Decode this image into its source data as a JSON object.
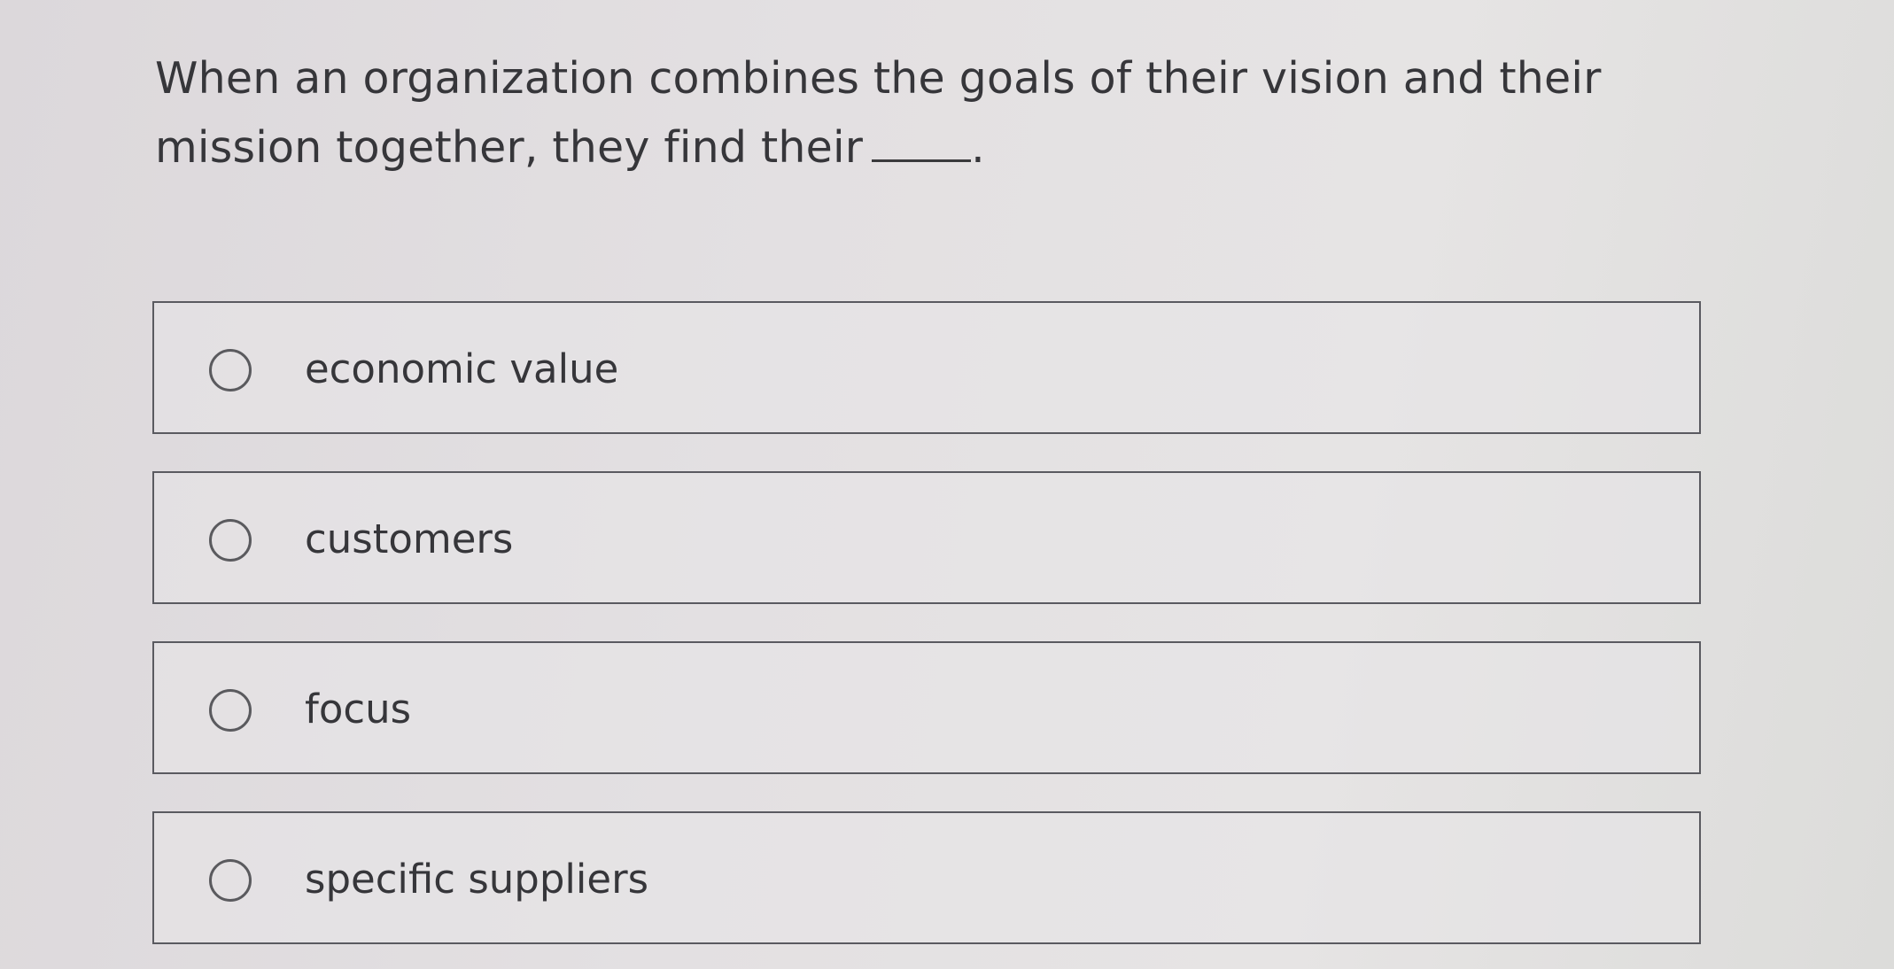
{
  "question": {
    "text_before_blank": "When an organization combines the goals of their vision and their mission together, they find their",
    "text_after_blank": "."
  },
  "options": [
    {
      "label": "economic value",
      "selected": false
    },
    {
      "label": "customers",
      "selected": false
    },
    {
      "label": "focus",
      "selected": false
    },
    {
      "label": "specific suppliers",
      "selected": false
    }
  ]
}
